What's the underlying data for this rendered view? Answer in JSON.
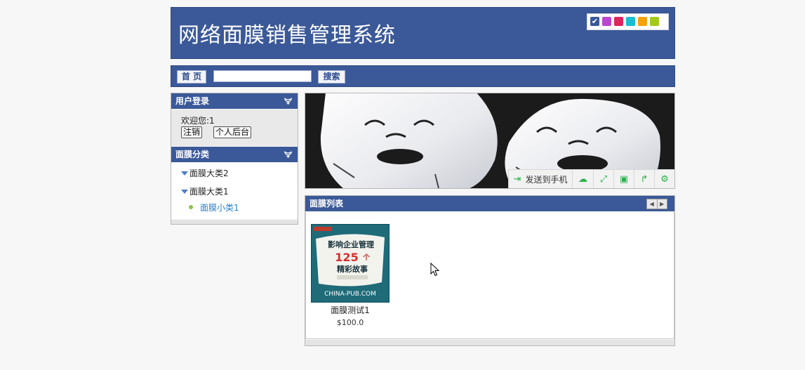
{
  "header": {
    "title": "网络面膜销售管理系统",
    "color_swatches": [
      {
        "color": "#3b5998",
        "selected": true
      },
      {
        "color": "#b948cf",
        "selected": false
      },
      {
        "color": "#e0245e",
        "selected": false
      },
      {
        "color": "#1bbdd1",
        "selected": false
      },
      {
        "color": "#f5a20b",
        "selected": false
      },
      {
        "color": "#a4c91a",
        "selected": false
      }
    ]
  },
  "nav": {
    "home_label": "首 页",
    "search_value": "",
    "search_label": "搜索"
  },
  "login": {
    "title": "用户登录",
    "welcome": "欢迎您:1",
    "logout_label": "注销",
    "backend_label": "个人后台"
  },
  "categories": {
    "title": "面膜分类",
    "items": [
      {
        "label": "面膜大类2",
        "type": "parent"
      },
      {
        "label": "面膜大类1",
        "type": "parent"
      },
      {
        "label": "面膜小类1",
        "type": "child"
      }
    ]
  },
  "share_bar": {
    "send_label": "发送到手机",
    "icons": [
      "phone-send-icon",
      "cloud-icon",
      "fullscreen-icon",
      "save-icon",
      "share-icon",
      "settings-gear-icon"
    ]
  },
  "product_list": {
    "title": "面膜列表",
    "products": [
      {
        "name": "面膜测试1",
        "price": "$100.0",
        "cover_title_line1": "影响企业管理",
        "cover_title_num": "125",
        "cover_title_unit": "个",
        "cover_title_line2": "精彩故事",
        "cover_site": "CHINA-PUB.COM"
      }
    ]
  },
  "colors": {
    "primary": "#3b5998",
    "accent_green": "#2bb24c"
  }
}
